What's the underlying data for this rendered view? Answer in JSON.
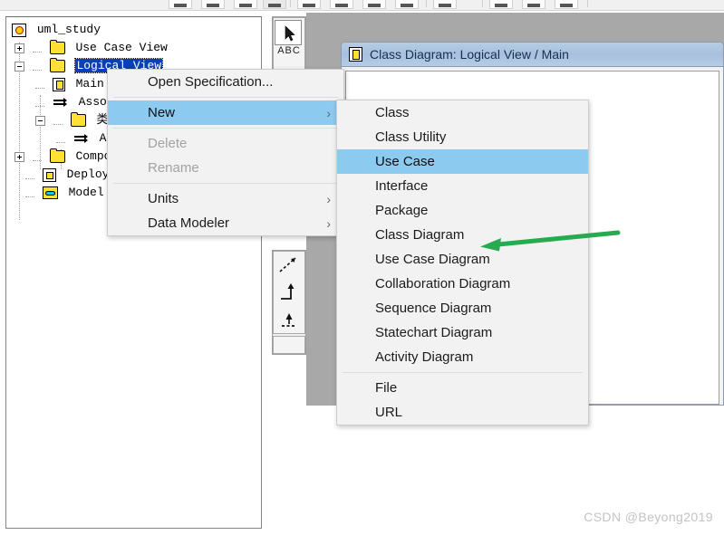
{
  "app": {
    "watermark": "CSDN @Beyong2019"
  },
  "toolbar": {
    "buttons": [
      {
        "name": "toolbar-button-1",
        "label": ""
      },
      {
        "name": "toolbar-button-2",
        "label": ""
      },
      {
        "name": "toolbar-button-3",
        "label": ""
      },
      {
        "name": "toolbar-button-4",
        "label": ""
      },
      {
        "name": "toolbar-button-5",
        "label": ""
      },
      {
        "name": "toolbar-button-6",
        "label": ""
      },
      {
        "name": "toolbar-button-7",
        "label": ""
      },
      {
        "name": "toolbar-button-8",
        "label": ""
      },
      {
        "name": "toolbar-button-9",
        "label": ""
      },
      {
        "name": "toolbar-button-10",
        "label": ""
      },
      {
        "name": "toolbar-button-11",
        "label": ""
      },
      {
        "name": "toolbar-button-12",
        "label": ""
      }
    ]
  },
  "tree": {
    "nodes": [
      {
        "label": "uml_study",
        "icon": "model-icon",
        "indent": 0,
        "expander": "none",
        "selected": false
      },
      {
        "label": "Use Case View",
        "icon": "folder-icon",
        "indent": 1,
        "expander": "plus",
        "selected": false
      },
      {
        "label": "Logical View",
        "icon": "folder-icon",
        "indent": 1,
        "expander": "minus",
        "selected": true
      },
      {
        "label": "Main",
        "icon": "diagram-icon",
        "indent": 2,
        "expander": "none",
        "selected": false
      },
      {
        "label": "Asso",
        "icon": "association-icon",
        "indent": 2,
        "expander": "none",
        "selected": false
      },
      {
        "label": "类图",
        "icon": "folder-icon",
        "indent": 2,
        "expander": "minus",
        "selected": false
      },
      {
        "label": "A",
        "icon": "association-icon",
        "indent": 3,
        "expander": "none",
        "selected": false
      },
      {
        "label": "Componen",
        "icon": "folder-icon",
        "indent": 1,
        "expander": "plus",
        "selected": false
      },
      {
        "label": "Deploym",
        "icon": "deployment-icon",
        "indent": 1,
        "expander": "none",
        "selected": false
      },
      {
        "label": "Model Pr",
        "icon": "properties-icon",
        "indent": 1,
        "expander": "none",
        "selected": false
      }
    ]
  },
  "drawing_toolbar": {
    "tools": [
      {
        "name": "select-arrow-tool",
        "icon": "cursor-arrow-icon",
        "label": ""
      },
      {
        "name": "text-tool",
        "icon": "abc-text-icon",
        "label": "ABC"
      },
      {
        "name": "dependency-tool",
        "icon": "dashed-arrow-icon",
        "label": ""
      },
      {
        "name": "transition-tool",
        "icon": "transition-icon",
        "label": ""
      },
      {
        "name": "transition-to-self-tool",
        "icon": "transition-self-icon",
        "label": ""
      }
    ]
  },
  "diagram_window": {
    "title": "Class Diagram: Logical View / Main",
    "title_icon": "class-diagram-icon"
  },
  "context_menu": {
    "items": [
      {
        "label": "Open Specification...",
        "submenu": false,
        "disabled": false,
        "highlighted": false,
        "separator_after": true
      },
      {
        "label": "New",
        "submenu": true,
        "disabled": false,
        "highlighted": true,
        "separator_after": true
      },
      {
        "label": "Delete",
        "submenu": false,
        "disabled": true,
        "highlighted": false,
        "separator_after": false
      },
      {
        "label": "Rename",
        "submenu": false,
        "disabled": true,
        "highlighted": false,
        "separator_after": true
      },
      {
        "label": "Units",
        "submenu": true,
        "disabled": false,
        "highlighted": false,
        "separator_after": false
      },
      {
        "label": "Data Modeler",
        "submenu": true,
        "disabled": false,
        "highlighted": false,
        "separator_after": false
      }
    ]
  },
  "new_submenu": {
    "items": [
      {
        "label": "Class",
        "highlighted": false,
        "separator_after": false
      },
      {
        "label": "Class Utility",
        "highlighted": false,
        "separator_after": false
      },
      {
        "label": "Use Case",
        "highlighted": true,
        "separator_after": false
      },
      {
        "label": "Interface",
        "highlighted": false,
        "separator_after": false
      },
      {
        "label": "Package",
        "highlighted": false,
        "separator_after": false
      },
      {
        "label": "Class Diagram",
        "highlighted": false,
        "separator_after": false
      },
      {
        "label": "Use Case Diagram",
        "highlighted": false,
        "separator_after": false
      },
      {
        "label": "Collaboration Diagram",
        "highlighted": false,
        "separator_after": false
      },
      {
        "label": "Sequence Diagram",
        "highlighted": false,
        "separator_after": false
      },
      {
        "label": "Statechart Diagram",
        "highlighted": false,
        "separator_after": false
      },
      {
        "label": "Activity Diagram",
        "highlighted": false,
        "separator_after": true
      },
      {
        "label": "File",
        "highlighted": false,
        "separator_after": false
      },
      {
        "label": "URL",
        "highlighted": false,
        "separator_after": false
      }
    ]
  },
  "annotation": {
    "arrow_color": "#2aa council",
    "color": "#27ab50",
    "points_to": "Class Diagram"
  }
}
